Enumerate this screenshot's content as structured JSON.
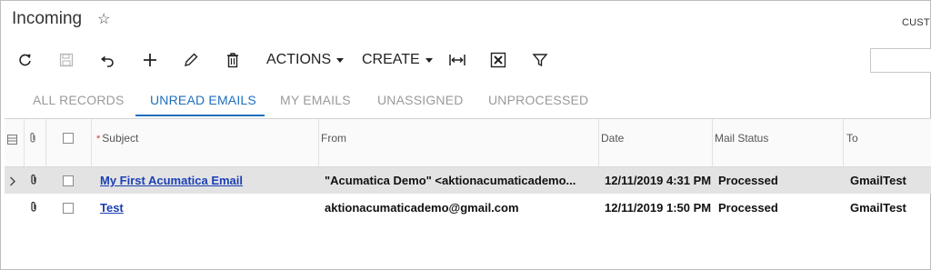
{
  "header": {
    "title": "Incoming",
    "star_glyph": "☆",
    "top_right_label": "CUST"
  },
  "toolbar": {
    "icons": [
      "refresh-icon",
      "save-icon",
      "undo-icon",
      "add-icon",
      "edit-icon",
      "delete-icon"
    ],
    "actions_label": "ACTIONS",
    "create_label": "CREATE",
    "fit_columns_icon": "fit-columns-icon",
    "excel_icon": "excel-export-icon",
    "filter_icon": "filter-icon",
    "search_placeholder": ""
  },
  "tabs": [
    {
      "label": "ALL RECORDS",
      "active": false
    },
    {
      "label": "UNREAD EMAILS",
      "active": true
    },
    {
      "label": "MY EMAILS",
      "active": false
    },
    {
      "label": "UNASSIGNED",
      "active": false
    },
    {
      "label": "UNPROCESSED",
      "active": false
    }
  ],
  "grid": {
    "columns": [
      "Subject",
      "From",
      "Date",
      "Mail Status",
      "To"
    ],
    "rows": [
      {
        "subject": "My First Acumatica Email",
        "from": "\"Acumatica Demo\" <aktionacumaticademo...",
        "date": "12/11/2019 4:31 PM",
        "status": "Processed",
        "to": "GmailTest",
        "selected": true
      },
      {
        "subject": "Test",
        "from": "aktionacumaticademo@gmail.com",
        "date": "12/11/2019 1:50 PM",
        "status": "Processed",
        "to": "GmailTest",
        "selected": false
      }
    ]
  },
  "colors": {
    "accent": "#1f6fbd",
    "link": "#1b3fb5",
    "selected_row": "#e3e3e3",
    "required": "#d03b3b"
  }
}
